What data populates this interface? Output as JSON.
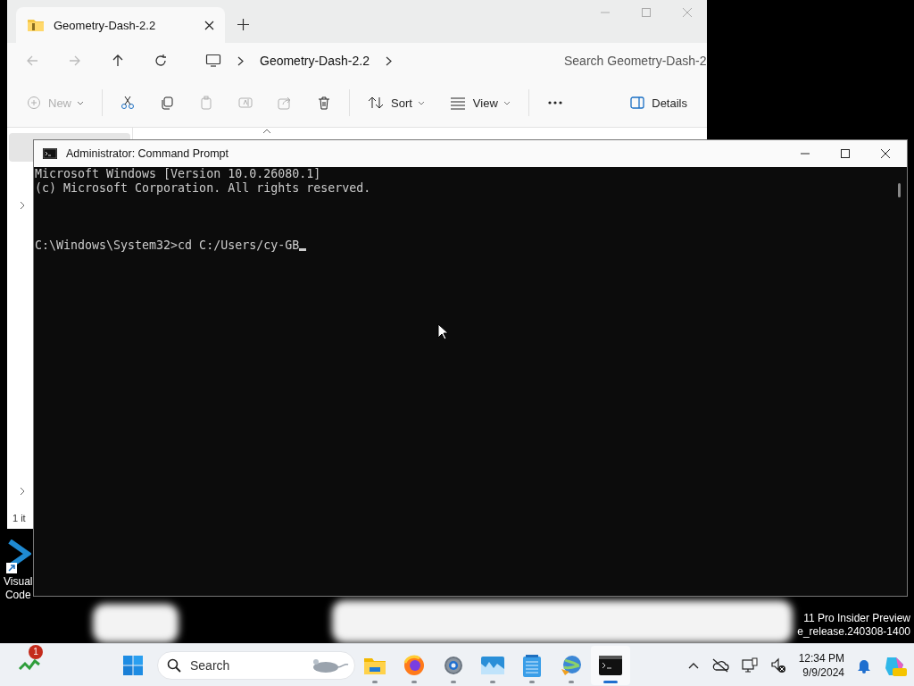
{
  "explorer": {
    "tab_title": "Geometry-Dash-2.2",
    "breadcrumb": [
      "Geometry-Dash-2.2"
    ],
    "search": {
      "placeholder": "Search Geometry-Dash-2"
    },
    "toolbar": [
      {
        "kind": "new",
        "label": "New",
        "disabled": true
      },
      {
        "kind": "cut",
        "disabled": false
      },
      {
        "kind": "copy",
        "disabled": false
      },
      {
        "kind": "paste",
        "disabled": true
      },
      {
        "kind": "rename",
        "disabled": true
      },
      {
        "kind": "share",
        "disabled": true
      },
      {
        "kind": "delete",
        "disabled": false
      },
      {
        "kind": "sort",
        "label": "Sort",
        "disabled": false
      },
      {
        "kind": "view",
        "label": "View",
        "disabled": false
      },
      {
        "kind": "more",
        "disabled": false
      }
    ],
    "details": "Details",
    "status": "1 it"
  },
  "cmd": {
    "title": "Administrator: Command Prompt",
    "header": [
      "Microsoft Windows [Version 10.0.26080.1]",
      "(c) Microsoft Corporation. All rights reserved."
    ],
    "prompt": "C:\\Windows\\System32>cd C:/Users/cy-GB"
  },
  "desktop_icons": [
    {
      "kind": "vscode",
      "label_lines": [
        "Visual",
        "Code"
      ]
    }
  ],
  "watermark": [
    "11 Pro Insider Preview",
    "e_release.240308-1400"
  ],
  "taskbar": {
    "widget_badge": "1",
    "search": {
      "placeholder": "Search"
    },
    "apps": [
      {
        "kind": "explorer",
        "selected": false
      },
      {
        "kind": "firefox",
        "selected": false
      },
      {
        "kind": "settings",
        "selected": false
      },
      {
        "kind": "photos",
        "selected": false
      },
      {
        "kind": "notepad",
        "selected": false
      },
      {
        "kind": "download",
        "selected": false
      },
      {
        "kind": "terminal",
        "selected": true
      }
    ],
    "time": "12:34 PM",
    "date": "9/9/2024"
  }
}
